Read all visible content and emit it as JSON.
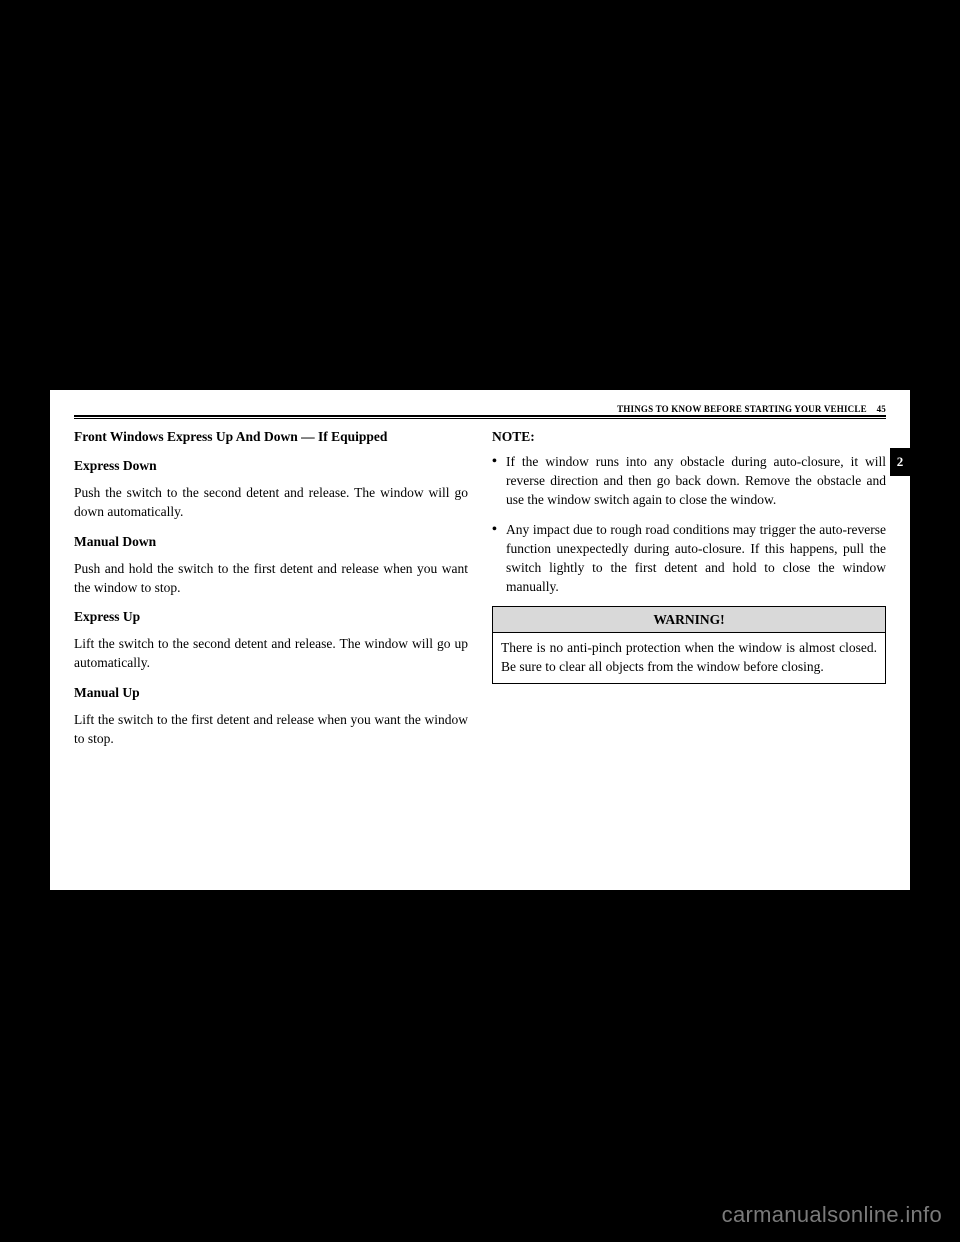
{
  "header": {
    "running": "THINGS TO KNOW BEFORE STARTING YOUR VEHICLE",
    "page_number": "45",
    "tab_number": "2"
  },
  "left": {
    "title": "Front Windows Express Up And Down — If Equipped",
    "sub1": "Express Down",
    "para1": "Push the switch to the second detent and release. The window will go down automatically.",
    "sub2": "Manual Down",
    "para2": "Push and hold the switch to the first detent and release when you want the window to stop.",
    "sub3": "Express Up",
    "para3": "Lift the switch to the second detent and release. The window will go up automatically.",
    "sub4": "Manual Up",
    "para4": "Lift the switch to the first detent and release when you want the window to stop."
  },
  "right": {
    "note_label": "NOTE:",
    "bullets": [
      "If the window runs into any obstacle during auto-closure, it will reverse direction and then go back down. Remove the obstacle and use the window switch again to close the window.",
      "Any impact due to rough road conditions may trigger the auto-reverse function unexpectedly during auto-closure. If this happens, pull the switch lightly to the first detent and hold to close the window manually."
    ],
    "warning_title": "WARNING!",
    "warning_body": "There is no anti-pinch protection when the window is almost closed. Be sure to clear all objects from the window before closing."
  },
  "watermark": "carmanualsonline.info"
}
